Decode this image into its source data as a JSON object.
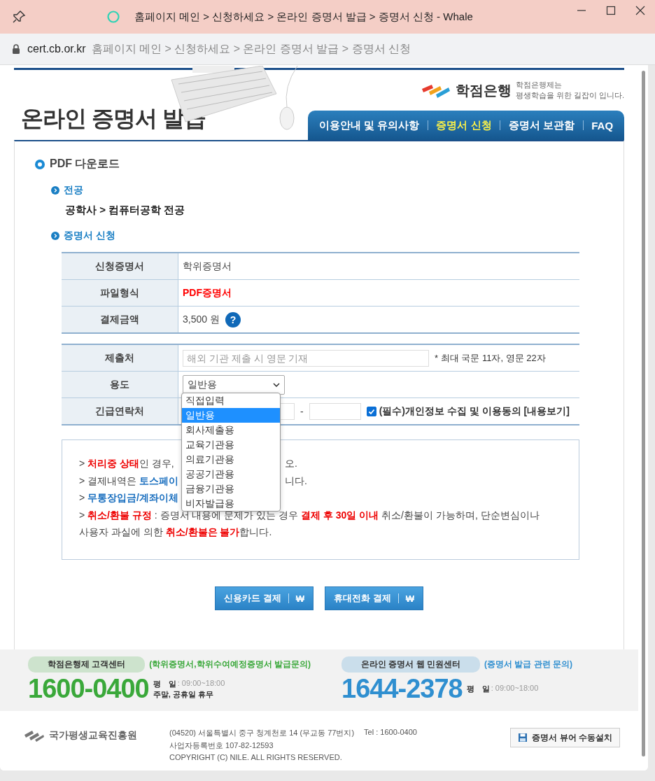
{
  "browser": {
    "title": "홈페이지 메인 > 신청하세요 > 온라인 증명서 발급 > 증명서 신청 - Whale",
    "domain": "cert.cb.or.kr",
    "path": "홈페이지 메인 > 신청하세요 > 온라인 증명서 발급 > 증명서 신청"
  },
  "header": {
    "title": "온라인 증명서 발급",
    "logo": "학점은행",
    "slogan_1": "학점은행제는",
    "slogan_2": "평생학습을 위한 길잡이 입니다."
  },
  "nav": [
    {
      "label": "이용안내 및 유의사항",
      "selected": false
    },
    {
      "label": "증명서 신청",
      "selected": true
    },
    {
      "label": "증명서 보관함",
      "selected": false
    },
    {
      "label": "FAQ",
      "selected": false
    }
  ],
  "section_title": "PDF 다운로드",
  "major": {
    "heading": "전공",
    "value": "공학사 > 컴퓨터공학 전공"
  },
  "application": {
    "heading": "증명서 신청",
    "rows": [
      {
        "label": "신청증명서",
        "value": "학위증명서",
        "kind": "plain"
      },
      {
        "label": "파일형식",
        "value": "PDF증명서",
        "kind": "emphasis"
      },
      {
        "label": "결제금액",
        "value": "3,500 원",
        "kind": "price",
        "help": "?"
      }
    ]
  },
  "form": {
    "recipient": {
      "label": "제출처",
      "placeholder": "해외 기관 제출 시 영문 기재",
      "note": "* 최대 국문 11자, 영문 22자"
    },
    "purpose": {
      "label": "용도",
      "value": "일반용",
      "options": [
        {
          "label": "직접입력",
          "selected": false
        },
        {
          "label": "일반용",
          "selected": true
        },
        {
          "label": "회사제출용",
          "selected": false
        },
        {
          "label": "교육기관용",
          "selected": false
        },
        {
          "label": "의료기관용",
          "selected": false
        },
        {
          "label": "공공기관용",
          "selected": false
        },
        {
          "label": "금융기관용",
          "selected": false
        },
        {
          "label": "비자발급용",
          "selected": false
        }
      ]
    },
    "contact": {
      "label": "긴급연락처",
      "separator": "-",
      "consent_checked": true,
      "consent": "(필수)개인정보 수집 및 이용동의 [내용보기]"
    }
  },
  "notices": [
    {
      "segments": [
        {
          "text": "> ",
          "kind": "plain"
        },
        {
          "text": "처리중 상태",
          "kind": "red"
        },
        {
          "text": "인 경우,",
          "kind": "plain"
        }
      ],
      "tail": "오."
    },
    {
      "segments": [
        {
          "text": "> 결제내역은 ",
          "kind": "plain"
        },
        {
          "text": "토스페이",
          "kind": "blue"
        }
      ],
      "tail": "니다."
    },
    {
      "segments": [
        {
          "text": "> ",
          "kind": "plain"
        },
        {
          "text": "무통장입금/계좌이체",
          "kind": "blue"
        }
      ]
    },
    {
      "segments": [
        {
          "text": "> ",
          "kind": "plain"
        },
        {
          "text": "취소/환불 규정",
          "kind": "red"
        },
        {
          "text": " : 증명서 내용에 문제가 있는 경우 ",
          "kind": "plain"
        },
        {
          "text": "결제 후 30일 이내",
          "kind": "red"
        },
        {
          "text": " 취소/환불이 가능하며, 단순변심이나 사용자 과실에 의한 ",
          "kind": "plain"
        },
        {
          "text": "취소/환불은 불가",
          "kind": "red"
        },
        {
          "text": "합니다.",
          "kind": "plain"
        }
      ]
    }
  ],
  "buttons": [
    {
      "label": "신용카드 결제",
      "symbol": "₩"
    },
    {
      "label": "휴대전화 결제",
      "symbol": "₩"
    }
  ],
  "footer": {
    "centers": [
      {
        "name": "학점은행제 고객센터",
        "note": "(학위증명서,학위수여예정증명서 발급문의)",
        "phone": "1600-0400",
        "hours_label": "평　일",
        "hours": ": 09:00~18:00",
        "closed": "주말, 공휴일 휴무",
        "color": "#3aa83a"
      },
      {
        "name": "온라인 증명서 웹 민원센터",
        "note": "(증명서 발급 관련 문의)",
        "phone": "1644-2378",
        "hours_label": "평　일",
        "hours": ": 09:00~18:00",
        "color": "#2f8fd0"
      }
    ],
    "org": "국가평생교육진흥원",
    "address": "(04520) 서울특별시 중구 청계천로 14 (무교동 77번지)",
    "tel": "Tel : 1600-0400",
    "biz_no": "사업자등록번호 107-82-12593",
    "copyright": "COPYRIGHT (C) NILE. ALL RIGHTS RESERVED.",
    "install_button": "증명서 뷰어 수동설치"
  }
}
